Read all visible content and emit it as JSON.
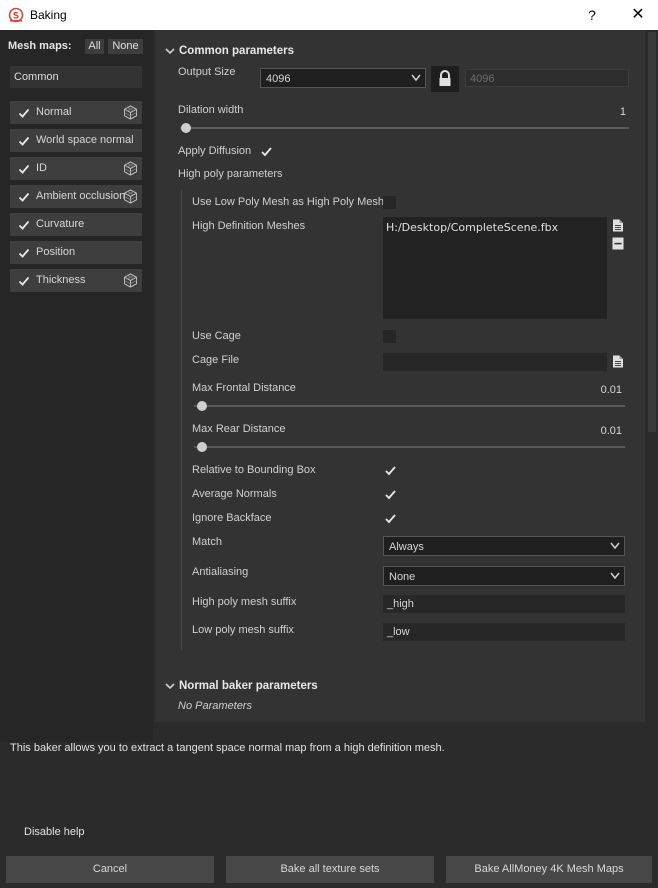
{
  "window": {
    "title": "Baking",
    "help_label": "?",
    "close_label": "✕"
  },
  "sidebar": {
    "label": "Mesh maps:",
    "all_label": "All",
    "none_label": "None",
    "common_label": "Common",
    "items": [
      {
        "label": "Normal",
        "has_cube": true
      },
      {
        "label": "World space normal",
        "has_cube": false
      },
      {
        "label": "ID",
        "has_cube": true
      },
      {
        "label": "Ambient occlusion",
        "has_cube": true
      },
      {
        "label": "Curvature",
        "has_cube": false
      },
      {
        "label": "Position",
        "has_cube": false
      },
      {
        "label": "Thickness",
        "has_cube": true
      }
    ]
  },
  "common": {
    "header": "Common parameters",
    "output_size_label": "Output Size",
    "output_size_value": "4096",
    "output_size_locked_value": "4096",
    "dilation_label": "Dilation width",
    "dilation_value": "1",
    "apply_diffusion_label": "Apply Diffusion",
    "high_poly_params_label": "High poly parameters",
    "use_low_poly_label": "Use Low Poly Mesh as High Poly Mesh",
    "high_def_label": "High Definition Meshes",
    "high_def_value": "H:/Desktop/CompleteScene.fbx",
    "use_cage_label": "Use Cage",
    "cage_file_label": "Cage File",
    "max_frontal_label": "Max Frontal Distance",
    "max_frontal_value": "0.01",
    "max_rear_label": "Max Rear Distance",
    "max_rear_value": "0.01",
    "relative_bbox_label": "Relative to Bounding Box",
    "average_normals_label": "Average Normals",
    "ignore_backface_label": "Ignore Backface",
    "match_label": "Match",
    "match_value": "Always",
    "antialiasing_label": "Antialiasing",
    "antialiasing_value": "None",
    "high_suffix_label": "High poly mesh suffix",
    "high_suffix_value": "_high",
    "low_suffix_label": "Low poly mesh suffix",
    "low_suffix_value": "_low"
  },
  "normal_baker": {
    "header": "Normal baker parameters",
    "no_params": "No Parameters"
  },
  "help_text": "This baker allows you to extract a tangent space normal map from a high definition mesh.",
  "disable_help_label": "Disable help",
  "buttons": {
    "cancel": "Cancel",
    "bake_all": "Bake all texture sets",
    "bake_one": "Bake AllMoney 4K Mesh Maps"
  },
  "colors": {
    "accent_red": "#d9473a",
    "panel": "#333333",
    "sidebar": "#262626"
  }
}
